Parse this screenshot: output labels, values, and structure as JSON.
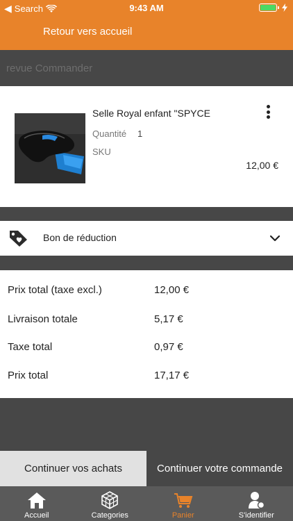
{
  "status_bar": {
    "back_app": "Search",
    "time": "9:43 AM",
    "wifi_icon": "wifi-icon",
    "battery_icon": "battery-icon",
    "charging_icon": "charging-icon"
  },
  "nav": {
    "title": "Retour vers accueil"
  },
  "section_header": {
    "text": "revue Commander"
  },
  "cart_item": {
    "name": "Selle Royal enfant \"SPYCE",
    "quantity_label": "Quantité",
    "quantity_value": "1",
    "sku_label": "SKU",
    "price": "12,00 €",
    "menu_icon": "more-vertical-icon",
    "image": "bicycle-saddle-photo"
  },
  "coupon": {
    "label": "Bon de réduction",
    "icon": "price-tag-heart-icon",
    "chevron_icon": "chevron-down-icon"
  },
  "totals": [
    {
      "label": "Prix total (taxe excl.)",
      "value": "12,00 €"
    },
    {
      "label": "Livraison totale",
      "value": "5,17 €"
    },
    {
      "label": "Taxe total",
      "value": "0,97 €"
    },
    {
      "label": "Prix total",
      "value": "17,17 €"
    }
  ],
  "actions": {
    "continue_shopping": "Continuer vos achats",
    "continue_order": "Continuer votre commande"
  },
  "tab_bar": {
    "tabs": [
      {
        "label": "Accueil",
        "icon": "home-icon"
      },
      {
        "label": "Categories",
        "icon": "cube-icon"
      },
      {
        "label": "Panier",
        "icon": "cart-icon",
        "active": true
      },
      {
        "label": "S'identifier",
        "icon": "user-icon"
      }
    ]
  },
  "colors": {
    "accent": "#e8832a",
    "dark": "#474747",
    "tab_bar": "#5a5a5a",
    "secondary_button": "#e1e1e1"
  }
}
